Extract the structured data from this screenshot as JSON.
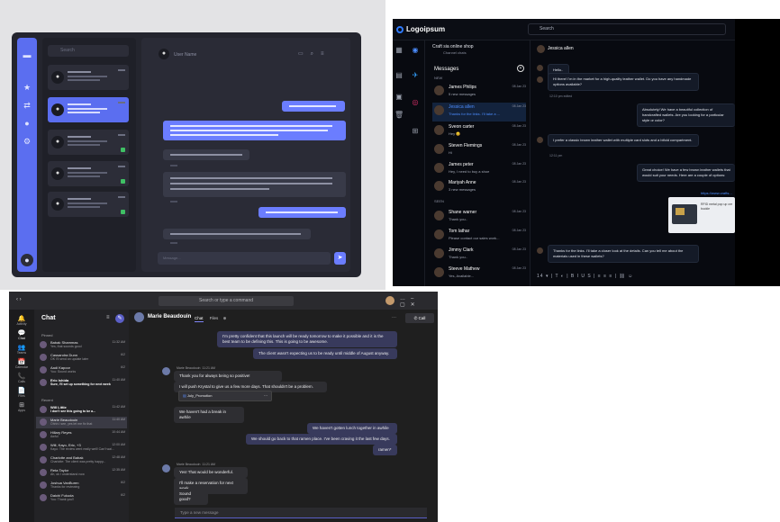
{
  "panel_a": {
    "search_placeholder": "Search",
    "chat_header_name": "User Name",
    "input_placeholder": "Message...",
    "send_icon": "➤",
    "rail_icons": [
      "chat-icon",
      "star-icon",
      "share-icon",
      "user-icon",
      "gear-icon"
    ],
    "colors": {
      "accent": "#5b6ef0",
      "bg": "#24252e"
    }
  },
  "panel_b": {
    "logo": "Logoipsum",
    "search_placeholder": "Search",
    "channel_title": "Craft sia online shop",
    "channel_subtitle": "Channel chats",
    "messages_title": "Messages",
    "section_new": "NEW",
    "section_seen": "SEEN",
    "active_contact": "Jessica allen",
    "conversations": [
      {
        "name": "James Philips",
        "preview": "5 new messages",
        "date": "08 Jan 23"
      },
      {
        "name": "Jessica allen",
        "preview": "Thanks for the links. I'll take a ...",
        "date": "08 Jan 23",
        "selected": true
      },
      {
        "name": "Sveon carter",
        "preview": "Hey 😊",
        "date": "08 Jan 23"
      },
      {
        "name": "Steven Flemings",
        "preview": "Hi",
        "date": "08 Jan 23"
      },
      {
        "name": "James peter",
        "preview": "Hey, I need to buy a shoe",
        "date": "08 Jan 23"
      },
      {
        "name": "Mariyah Anne",
        "preview": "3 new messages",
        "date": "08 Jan 23"
      },
      {
        "name": "Shane warner",
        "preview": "Thank you..",
        "date": "08 Jan 23"
      },
      {
        "name": "Tom lathar",
        "preview": "Please contact our sales work...",
        "date": "08 Jan 23"
      },
      {
        "name": "Jimmy Clark",
        "preview": "Thank you..",
        "date": "08 Jan 23"
      },
      {
        "name": "Steeve Mathew",
        "preview": "Yes, Available...",
        "date": "08 Jan 23"
      }
    ],
    "messages": [
      {
        "text": "Hello..",
        "from": "them"
      },
      {
        "text": "Hi there! I'm in the market for a high-quality leather wallet. Do you have any handmade options available?",
        "from": "them",
        "time": "12:10 pm edited"
      },
      {
        "text": "Absolutely! We have a beautiful collection of handcrafted wallets. Are you looking for a particular style or color?",
        "from": "me"
      },
      {
        "text": "I prefer a classic brown leather wallet with multiple card slots and a bifold compartment.",
        "from": "them",
        "time": "12:11 pm"
      },
      {
        "text": "Great choice! We have a few brown leather wallets that would suit your needs. Here are a couple of options:",
        "from": "me"
      },
      {
        "text": "https://www.crafts...",
        "from": "me"
      },
      {
        "text": "RFID metal pop up cre buckle",
        "from": "me"
      },
      {
        "text": "Thanks for the links. I'll take a closer look at the details. Can you tell me about the materials used in these wallets?",
        "from": "them"
      }
    ],
    "toolbar": "14 ▾ | T ◐ | B I U S | ≡ ≡ ≡ | ⛓ ☺"
  },
  "panel_c": {
    "search_placeholder": "Search or type a command",
    "list_title": "Chat",
    "section_pinned": "Pinned",
    "section_recent": "Recent",
    "nav": [
      {
        "icon": "🔔",
        "label": "Activity"
      },
      {
        "icon": "💬",
        "label": "Chat"
      },
      {
        "icon": "👥",
        "label": "Teams"
      },
      {
        "icon": "📅",
        "label": "Calendar"
      },
      {
        "icon": "📞",
        "label": "Calls"
      },
      {
        "icon": "📄",
        "label": "Files"
      },
      {
        "icon": "⊞",
        "label": "Apps"
      }
    ],
    "pinned": [
      {
        "name": "Babak Shammas",
        "preview": "Yes, that sounds good",
        "time": "11:32 AM"
      },
      {
        "name": "Cassandra Dunn",
        "preview": "OK I'll send an update later",
        "time": "6/2"
      },
      {
        "name": "Aadi Kapoor",
        "preview": "You: Sound works",
        "time": "6/2"
      },
      {
        "name": "Eric Ishida",
        "preview": "Sure, I'll set up something for next week",
        "time": "11:40 AM",
        "bold": true
      }
    ],
    "recent": [
      {
        "name": "Will Little",
        "preview": "I don't see this going to be a...",
        "time": "11:42 AM",
        "bold": true
      },
      {
        "name": "Marie Beaudouin",
        "preview": "Ohhh I see, yes let me fix that",
        "time": "11:40 AM",
        "selected": true
      },
      {
        "name": "Hillary Reyes",
        "preview": "Awful",
        "time": "10:44 AM"
      },
      {
        "name": "Will, Kayo, Eric, +3",
        "preview": "Kayo: The review went really well! Can't wai...",
        "time": "12:00 AM"
      },
      {
        "name": "Charlotte and Babak",
        "preview": "Charlotte: The client was pretty happy...",
        "time": "12:48 AM"
      },
      {
        "name": "Reta Taylor",
        "preview": "Ah, ok I understand now",
        "time": "12:35 AM"
      },
      {
        "name": "Joshua VanBuren",
        "preview": "Thanks for reviewing",
        "time": "6/2"
      },
      {
        "name": "Daichi Fukuda",
        "preview": "You: Thank you!!",
        "time": "6/2"
      }
    ],
    "header_name": "Marie Beaudouin",
    "tabs": [
      "Chat",
      "Files"
    ],
    "call_label": "Call",
    "file_name": "July_Promotion",
    "sender": "Marie Beaudouin",
    "sender_time": "11:21 AM",
    "messages": [
      {
        "text": "I'm pretty confident that this launch will be ready tomorrow to make it possible and it is the best team to be defining this. This is going to be awesome.",
        "from": "me"
      },
      {
        "text": "The client wasn't expecting us to be ready until middle of August anyway.",
        "from": "me"
      },
      {
        "text": "Thank you for always being so positive!",
        "from": "them"
      },
      {
        "text": "I will push Krystal to give us a few more days. That shouldn't be a problem.",
        "from": "them"
      },
      {
        "text": "We haven't had a break in awhile",
        "from": "them"
      },
      {
        "text": "We haven't gotten lunch together in awhile",
        "from": "me"
      },
      {
        "text": "We should go back to that ramen place. I've been craving it the last few days.",
        "from": "me"
      },
      {
        "text": "ramen*",
        "from": "me"
      },
      {
        "text": "Yes! That would be wonderful.",
        "from": "them"
      },
      {
        "text": "I'll make a reservation for next week",
        "from": "them"
      },
      {
        "text": "Sound good?",
        "from": "them"
      }
    ],
    "input_placeholder": "Type a new message"
  }
}
